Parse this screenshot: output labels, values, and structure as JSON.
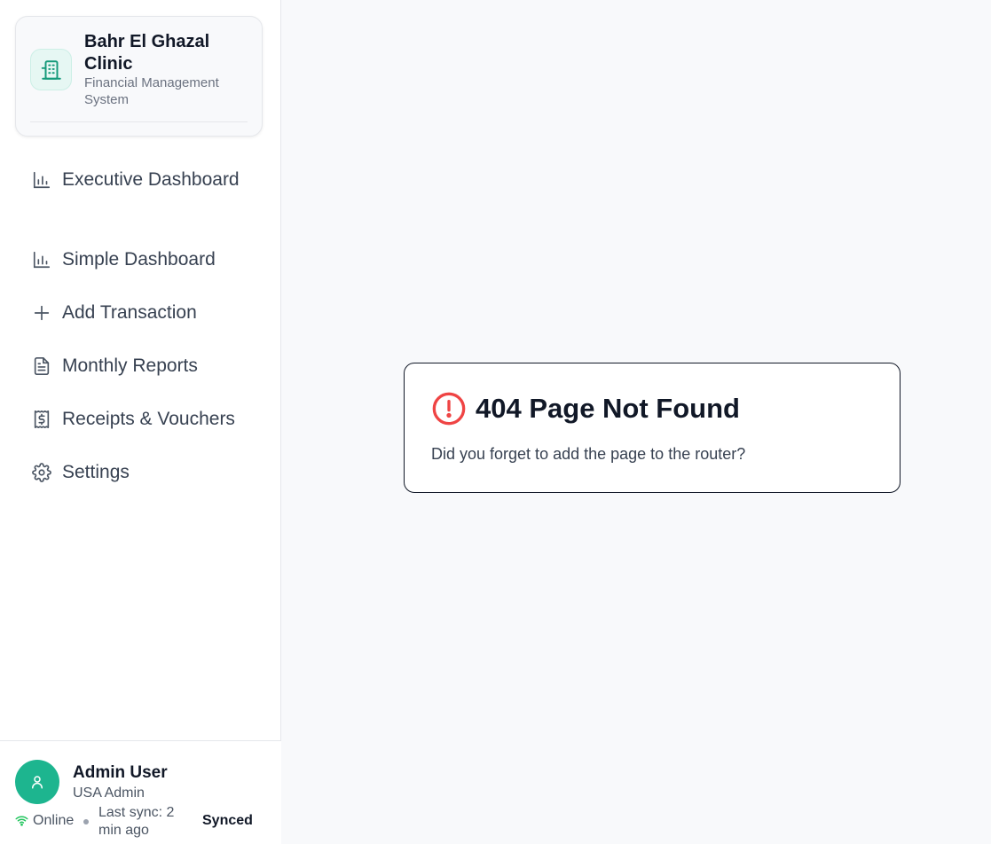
{
  "brand": {
    "name": "Bahr El Ghazal Clinic",
    "subtitle": "Financial Management System",
    "logo_icon": "building-icon",
    "accent": "#1db58f"
  },
  "nav": {
    "items": [
      {
        "label": "Executive Dashboard",
        "icon": "bar-chart-icon"
      },
      {
        "label": "Simple Dashboard",
        "icon": "bar-chart-icon"
      },
      {
        "label": "Add Transaction",
        "icon": "plus-icon"
      },
      {
        "label": "Monthly Reports",
        "icon": "file-text-icon"
      },
      {
        "label": "Receipts & Vouchers",
        "icon": "receipt-icon"
      },
      {
        "label": "Settings",
        "icon": "gear-icon"
      }
    ]
  },
  "user": {
    "name": "Admin User",
    "role": "USA Admin",
    "avatar_icon": "user-icon"
  },
  "status": {
    "connection": "Online",
    "last_sync": "Last sync: 2 min ago",
    "sync_state": "Synced",
    "online_color": "#22c55e"
  },
  "error": {
    "title": "404 Page Not Found",
    "message": "Did you forget to add the page to the router?",
    "icon": "alert-circle-icon",
    "icon_color": "#ef4444"
  }
}
